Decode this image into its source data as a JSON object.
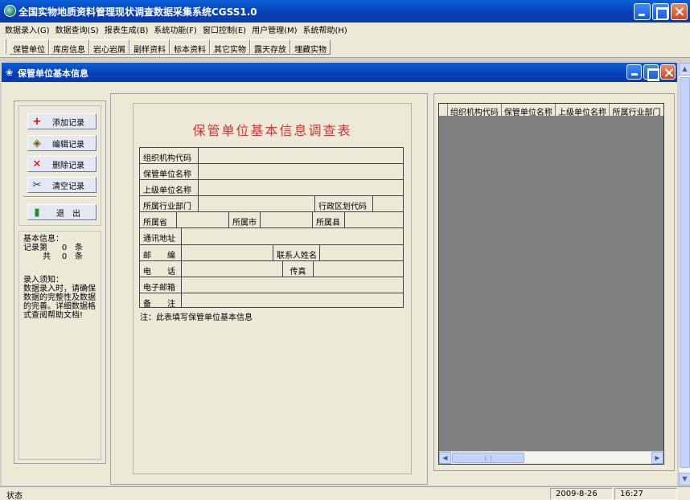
{
  "window": {
    "title": "全国实物地质资料管理现状调查数据采集系统CGSS1.0"
  },
  "menu": [
    "数据录入(G)",
    "数据查询(S)",
    "报表生成(B)",
    "系统功能(F)",
    "窗口控制(E)",
    "用户管理(M)",
    "系统帮助(H)"
  ],
  "toolbar": [
    "保管单位",
    "库房信息",
    "岩心岩屑",
    "副样资料",
    "标本资料",
    "其它实物",
    "露天存放",
    "埋藏实物"
  ],
  "child_window": {
    "title": "保管单位基本信息"
  },
  "actions": {
    "add": "添加记录",
    "edit": "编辑记录",
    "delete": "删除记录",
    "clear": "清空记录",
    "exit": "退　出"
  },
  "icons": {
    "add": "+",
    "edit": "◈",
    "delete": "✕",
    "clear": "✂",
    "exit": "▮"
  },
  "info": {
    "basic_heading": "基本信息：",
    "record_label": "记录第",
    "record_value": "0",
    "record_unit": "条",
    "total_label": "共",
    "total_value": "0",
    "total_unit": "条",
    "notice_heading": "录入须知：",
    "notice_text": "数据录入时，请确保数据的完整性及数据的完善。详细数据格式查阅帮助文档!"
  },
  "form": {
    "title": "保管单位基本信息调查表",
    "org_code": "组织机构代码",
    "unit_name": "保管单位名称",
    "parent_unit": "上级单位名称",
    "industry": "所属行业部门",
    "region_code": "行政区划代码",
    "province": "所属省",
    "city": "所属市",
    "county": "所属县",
    "address": "通讯地址",
    "postcode": "邮　　编",
    "contact": "联系人姓名",
    "phone": "电　　话",
    "fax": "传真",
    "email": "电子邮箱",
    "remark": "备　　注",
    "note": "注：此表填写保管单位基本信息"
  },
  "grid": {
    "columns": [
      "组织机构代码",
      "保管单位名称",
      "上级单位名称",
      "所属行业部门"
    ]
  },
  "status": {
    "label": "状态",
    "date": "2009-8-26",
    "time": "16:27"
  },
  "colors": {
    "title_blue": "#0840b8",
    "form_title_red": "#e03030",
    "grid_bg": "#808080"
  }
}
